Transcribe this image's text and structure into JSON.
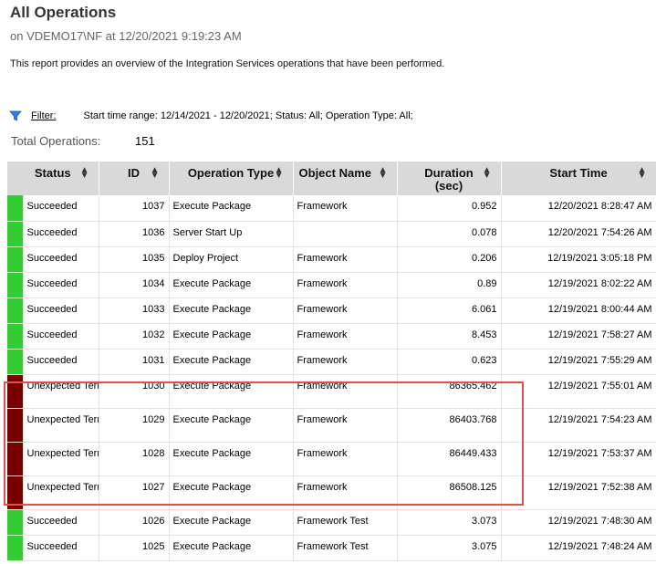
{
  "report": {
    "title": "All Operations",
    "subtitle": "on VDEMO17\\NF at 12/20/2021 9:19:23 AM",
    "description": "This report provides an overview of the Integration Services operations that have been performed."
  },
  "filter": {
    "link_label": "Filter:",
    "text": "Start time range: 12/14/2021 - 12/20/2021;  Status: All;  Operation Type: All;",
    "icon": "funnel-icon"
  },
  "summary": {
    "total_label": "Total Operations:",
    "total_value": "151"
  },
  "table": {
    "columns": [
      "Status",
      "ID",
      "Operation Type",
      "Object Name",
      "Duration (sec)",
      "Start Time"
    ],
    "rows": [
      {
        "status": "Succeeded",
        "id": "1037",
        "op": "Execute Package",
        "obj": "Framework",
        "dur": "0.952",
        "start": "12/20/2021 8:28:47 AM",
        "color": "#33cc33"
      },
      {
        "status": "Succeeded",
        "id": "1036",
        "op": "Server Start Up",
        "obj": "",
        "dur": "0.078",
        "start": "12/20/2021 7:54:26 AM",
        "color": "#33cc33"
      },
      {
        "status": "Succeeded",
        "id": "1035",
        "op": "Deploy Project",
        "obj": "Framework",
        "dur": "0.206",
        "start": "12/19/2021 3:05:18 PM",
        "color": "#33cc33"
      },
      {
        "status": "Succeeded",
        "id": "1034",
        "op": "Execute Package",
        "obj": "Framework",
        "dur": "0.89",
        "start": "12/19/2021 8:02:22 AM",
        "color": "#33cc33"
      },
      {
        "status": "Succeeded",
        "id": "1033",
        "op": "Execute Package",
        "obj": "Framework",
        "dur": "6.061",
        "start": "12/19/2021 8:00:44 AM",
        "color": "#33cc33"
      },
      {
        "status": "Succeeded",
        "id": "1032",
        "op": "Execute Package",
        "obj": "Framework",
        "dur": "8.453",
        "start": "12/19/2021 7:58:27 AM",
        "color": "#33cc33"
      },
      {
        "status": "Succeeded",
        "id": "1031",
        "op": "Execute Package",
        "obj": "Framework",
        "dur": "0.623",
        "start": "12/19/2021 7:55:29 AM",
        "color": "#33cc33"
      },
      {
        "status": "Unexpected Termination",
        "id": "1030",
        "op": "Execute Package",
        "obj": "Framework",
        "dur": "86365.462",
        "start": "12/19/2021 7:55:01 AM",
        "color": "#7a0000"
      },
      {
        "status": "Unexpected Termination",
        "id": "1029",
        "op": "Execute Package",
        "obj": "Framework",
        "dur": "86403.768",
        "start": "12/19/2021 7:54:23 AM",
        "color": "#7a0000"
      },
      {
        "status": "Unexpected Termination",
        "id": "1028",
        "op": "Execute Package",
        "obj": "Framework",
        "dur": "86449.433",
        "start": "12/19/2021 7:53:37 AM",
        "color": "#7a0000"
      },
      {
        "status": "Unexpected Termination",
        "id": "1027",
        "op": "Execute Package",
        "obj": "Framework",
        "dur": "86508.125",
        "start": "12/19/2021 7:52:38 AM",
        "color": "#7a0000"
      },
      {
        "status": "Succeeded",
        "id": "1026",
        "op": "Execute Package",
        "obj": "Framework Test",
        "dur": "3.073",
        "start": "12/19/2021 7:48:30 AM",
        "color": "#33cc33"
      },
      {
        "status": "Succeeded",
        "id": "1025",
        "op": "Execute Package",
        "obj": "Framework Test",
        "dur": "3.075",
        "start": "12/19/2021 7:48:24 AM",
        "color": "#33cc33"
      }
    ]
  },
  "colors": {
    "succeeded": "#33cc33",
    "unexpected_termination": "#7a0000",
    "highlight_box": "#d9534f",
    "header_bg": "#d9d9d9"
  }
}
